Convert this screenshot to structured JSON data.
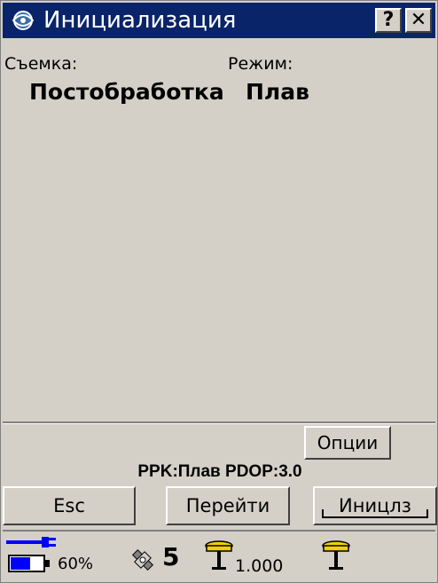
{
  "window": {
    "title": "Инициализация",
    "help_label": "?",
    "close_label": "✕"
  },
  "survey": {
    "label": "Съемка:",
    "value": "Постобработка"
  },
  "mode": {
    "label": "Режим:",
    "value": "Плав"
  },
  "buttons": {
    "options": "Опции",
    "esc": "Esc",
    "go": "Перейти",
    "init": "Иницлз"
  },
  "status_line": "PPK:Плав PDOP:3.0",
  "statusbar": {
    "battery_percent": "60%",
    "battery_level": 60,
    "satellites": "5",
    "antenna_height": "1.000"
  },
  "colors": {
    "titlebar": "#0a246a",
    "face": "#d4d0c8",
    "power_blue": "#0000ff",
    "antenna_yellow": "#f0d000"
  }
}
